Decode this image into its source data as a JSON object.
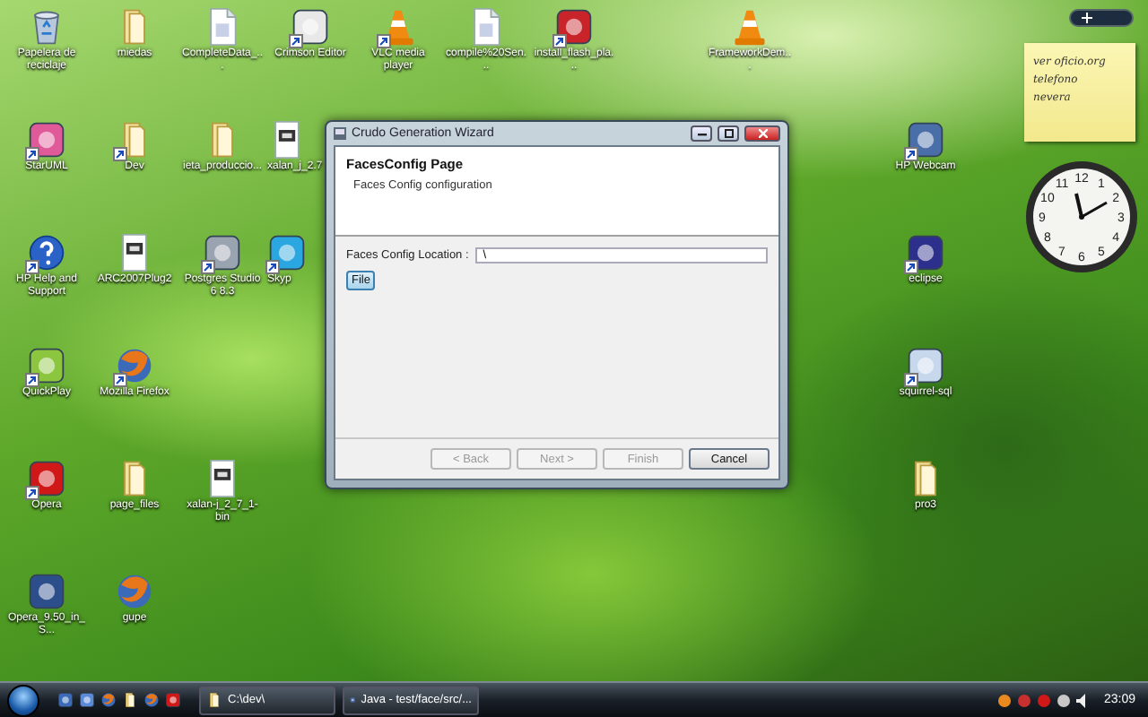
{
  "desktop_icons": [
    {
      "label": "Papelera de reciclaje",
      "kind": "bin",
      "shortcut": false
    },
    {
      "label": "miedas",
      "kind": "folder",
      "shortcut": false
    },
    {
      "label": "CompleteData_...",
      "kind": "file",
      "shortcut": false
    },
    {
      "label": "Crimson Editor",
      "kind": "app",
      "color": "#e8e8e8",
      "shortcut": true
    },
    {
      "label": "VLC media player",
      "kind": "cone",
      "shortcut": true
    },
    {
      "label": "compile%20Sen...",
      "kind": "file",
      "shortcut": false
    },
    {
      "label": "install_flash_pla...",
      "kind": "app",
      "color": "#c8242a",
      "shortcut": true
    },
    {
      "label": "FrameworkDem...",
      "kind": "cone",
      "shortcut": false
    },
    {
      "label": "StarUML",
      "kind": "app",
      "color": "#e05a9a",
      "shortcut": true
    },
    {
      "label": "Dev",
      "kind": "folder",
      "shortcut": true
    },
    {
      "label": "ieta_produccio...",
      "kind": "folder",
      "shortcut": false
    },
    {
      "label": "xalan_j_2.7",
      "kind": "archive",
      "shortcut": false
    },
    {
      "label": "HP Help and Support",
      "kind": "help",
      "shortcut": true
    },
    {
      "label": "ARC2007Plug2",
      "kind": "archive",
      "shortcut": false
    },
    {
      "label": "Postgres Studio 6 8.3",
      "kind": "app",
      "color": "#9aa3b0",
      "shortcut": true
    },
    {
      "label": "Skyp",
      "kind": "app",
      "color": "#2aa6e0",
      "shortcut": true
    },
    {
      "label": "QuickPlay",
      "kind": "app",
      "color": "#8cc63f",
      "shortcut": true
    },
    {
      "label": "Mozilla Firefox",
      "kind": "globe",
      "shortcut": true
    },
    {
      "label": "Opera",
      "kind": "app",
      "color": "#d01818",
      "shortcut": true
    },
    {
      "label": "page_files",
      "kind": "folder",
      "shortcut": false
    },
    {
      "label": "xalan-j_2_7_1-bin",
      "kind": "archive",
      "shortcut": false
    },
    {
      "label": "Opera_9.50_in_S...",
      "kind": "app",
      "color": "#2c4f8c",
      "shortcut": false
    },
    {
      "label": "gupe",
      "kind": "globe",
      "shortcut": false
    },
    {
      "label": "HP Webcam",
      "kind": "app",
      "color": "#4a6fa8",
      "shortcut": true
    },
    {
      "label": "eclipse",
      "kind": "app",
      "color": "#2c2f8c",
      "shortcut": true
    },
    {
      "label": "squirrel-sql",
      "kind": "app",
      "color": "#c8d8ec",
      "shortcut": true
    },
    {
      "label": "pro3",
      "kind": "folder",
      "shortcut": false
    }
  ],
  "sticky_note": {
    "lines": [
      "ver oficio.org",
      "telefono",
      "nevera"
    ]
  },
  "clock": {
    "numerals": [
      "11",
      "12",
      "1",
      "10",
      "2",
      "9",
      "3",
      "8",
      "4",
      "7",
      "6",
      "5"
    ]
  },
  "window": {
    "title": "Crudo Generation Wizard",
    "page_title": "FacesConfig Page",
    "page_description": "Faces Config configuration",
    "field": {
      "label": "Faces Config Location :",
      "value": "\\"
    },
    "file_button": "File",
    "buttons": [
      {
        "label": "< Back",
        "disabled": true
      },
      {
        "label": "Next >",
        "disabled": true
      },
      {
        "label": "Finish",
        "disabled": true
      },
      {
        "label": "Cancel",
        "disabled": false
      }
    ]
  },
  "taskbar": {
    "tasks": [
      {
        "label": "C:\\dev\\",
        "kind": "folder",
        "selected": false
      },
      {
        "label": "Java - test/face/src/...",
        "kind": "app",
        "selected": false
      }
    ],
    "clock": "23:09"
  }
}
